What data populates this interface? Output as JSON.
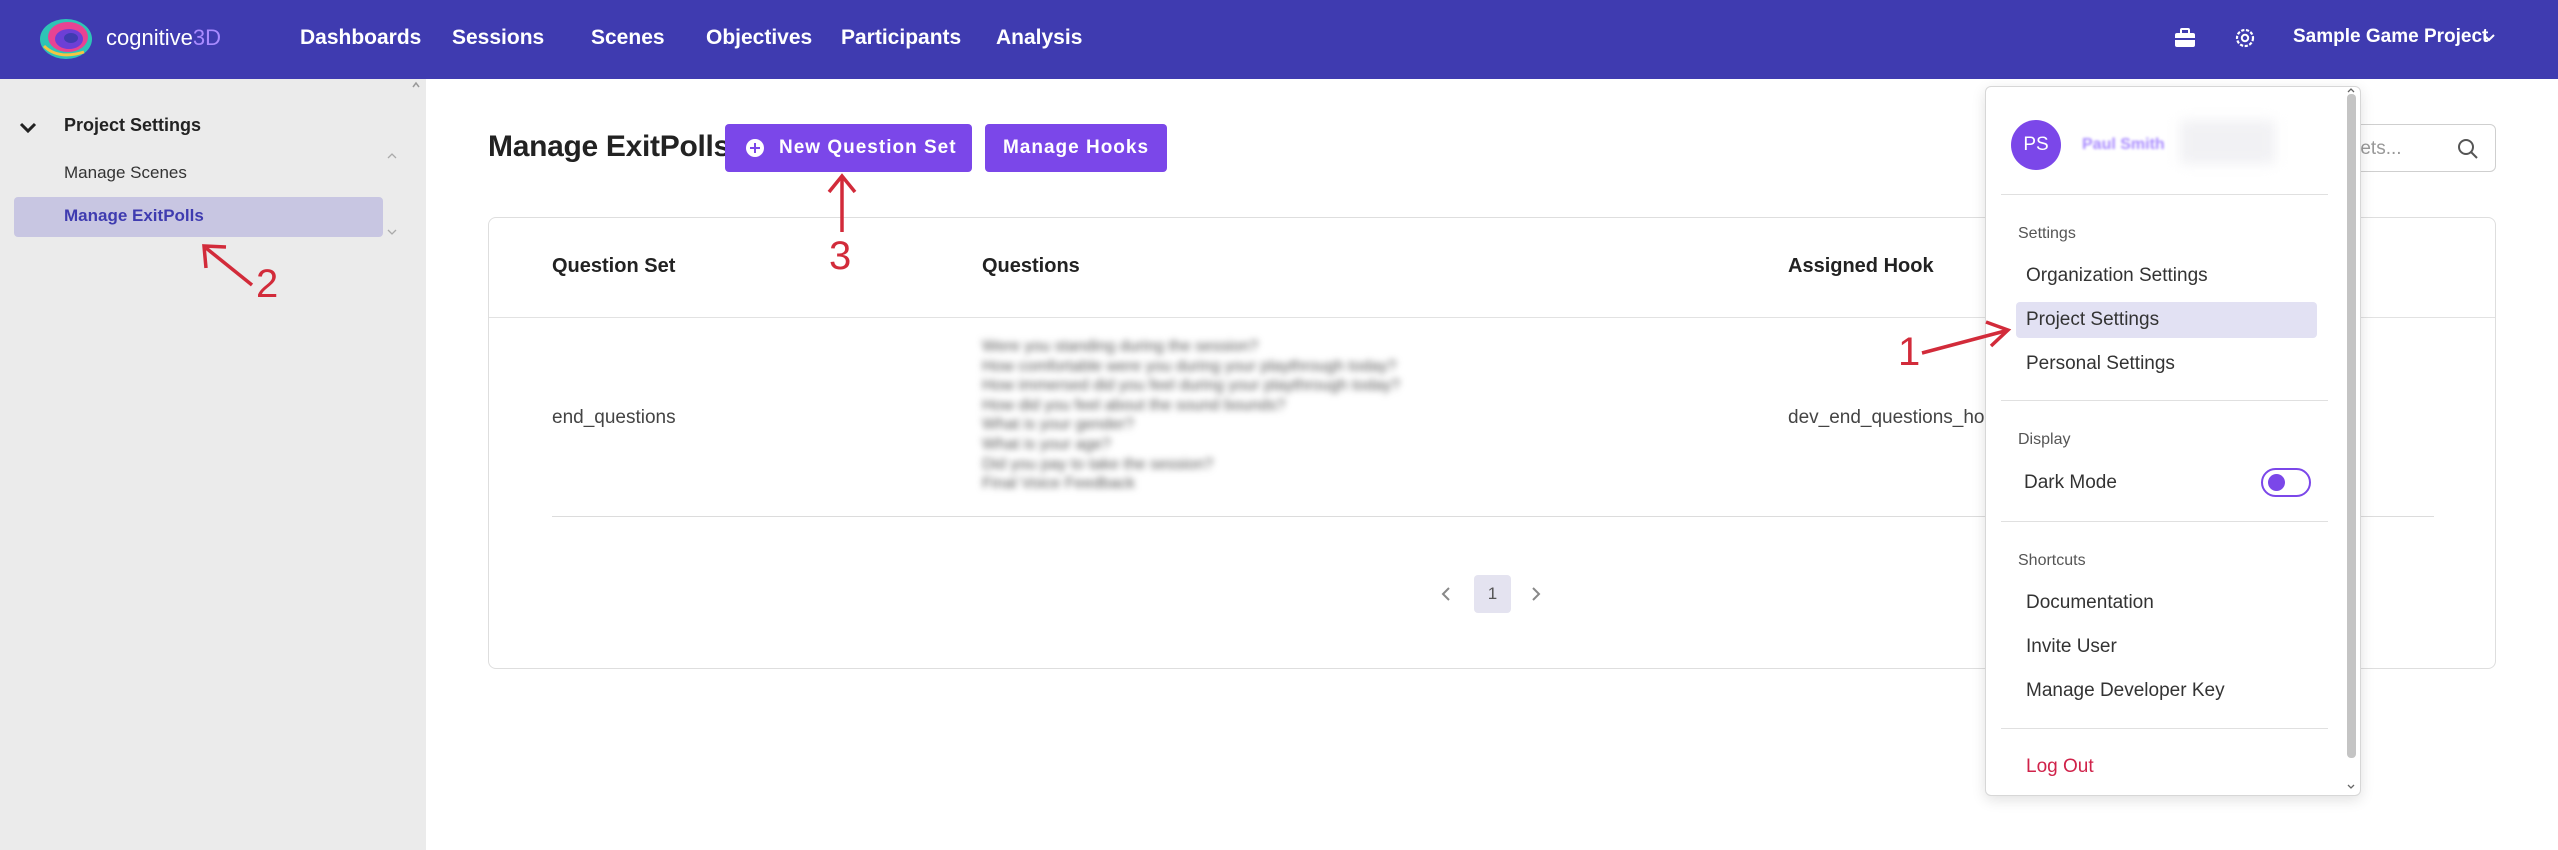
{
  "nav": {
    "logo_text": "cognitive",
    "logo_accent": "3D",
    "items": [
      {
        "label": "Dashboards"
      },
      {
        "label": "Sessions"
      },
      {
        "label": "Scenes"
      },
      {
        "label": "Objectives"
      },
      {
        "label": "Participants"
      },
      {
        "label": "Analysis"
      }
    ],
    "project": "Sample Game Project",
    "icons": [
      "briefcase-icon",
      "gear-icon",
      "chevron-down-icon"
    ]
  },
  "sidebar": {
    "header": "Project Settings",
    "items": [
      {
        "label": "Manage Scenes"
      },
      {
        "label": "Manage ExitPolls"
      }
    ]
  },
  "main": {
    "title": "Manage ExitPolls",
    "new_button": "New Question Set",
    "hooks_button": "Manage Hooks",
    "search_placeholder": "g sets...",
    "table": {
      "headers": [
        "Question Set",
        "Questions",
        "Assigned Hook"
      ],
      "rows": [
        {
          "question_set": "end_questions",
          "questions": [
            "Were you standing during the session?",
            "How comfortable were you during your playthrough today?",
            "How immersed did you feel during your playthrough today?",
            "How did you feel about the sound bounds?",
            "What is your gender?",
            "What is your age?",
            "Did you pay to take the session?",
            "Final Voice Feedback"
          ],
          "hook": "dev_end_questions_ho"
        }
      ]
    },
    "pagination": {
      "current": "1"
    }
  },
  "dropdown": {
    "avatar_initials": "PS",
    "user_name": "Paul Smith",
    "settings_label": "Settings",
    "settings_items": [
      {
        "label": "Organization Settings"
      },
      {
        "label": "Project Settings"
      },
      {
        "label": "Personal Settings"
      }
    ],
    "display_label": "Display",
    "dark_mode_label": "Dark Mode",
    "dark_mode_on": false,
    "shortcuts_label": "Shortcuts",
    "shortcut_items": [
      {
        "label": "Documentation"
      },
      {
        "label": "Invite User"
      },
      {
        "label": "Manage Developer Key"
      }
    ],
    "logout": "Log Out"
  },
  "annotations": {
    "one": "1",
    "two": "2",
    "three": "3"
  },
  "colors": {
    "nav_bg": "#3f3bb0",
    "accent": "#7b47e9",
    "annotation": "#d22b3a",
    "logout": "#d0224a"
  }
}
